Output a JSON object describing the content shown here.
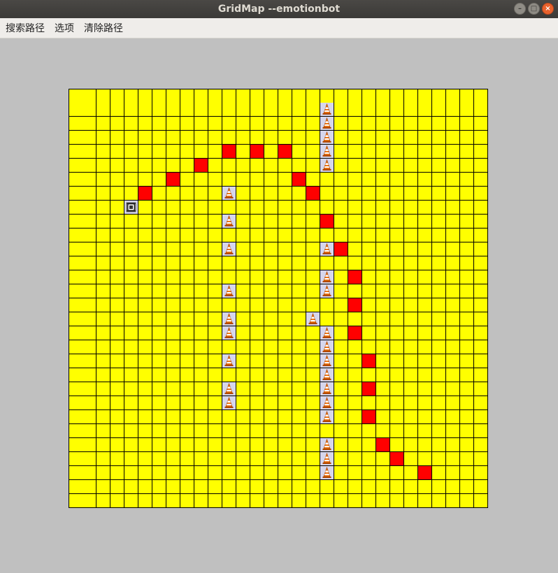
{
  "window": {
    "title": "GridMap --emotionbot"
  },
  "menu": {
    "items": [
      "搜索路径",
      "选项",
      "清除路径"
    ]
  },
  "colors": {
    "free": "#ffff00",
    "path": "#ff0000",
    "obstacle_bg": "#d6d6ec",
    "background": "#c0c0c0",
    "grid_line": "#000000"
  },
  "grid": {
    "rows": 30,
    "cols": 30,
    "robot": [
      8,
      4
    ],
    "obstacles": [
      [
        1,
        18
      ],
      [
        2,
        18
      ],
      [
        3,
        18
      ],
      [
        4,
        18
      ],
      [
        5,
        18
      ],
      [
        7,
        11
      ],
      [
        9,
        11
      ],
      [
        11,
        11
      ],
      [
        11,
        18
      ],
      [
        13,
        18
      ],
      [
        14,
        11
      ],
      [
        14,
        18
      ],
      [
        16,
        11
      ],
      [
        16,
        17
      ],
      [
        17,
        11
      ],
      [
        17,
        18
      ],
      [
        18,
        18
      ],
      [
        19,
        11
      ],
      [
        19,
        18
      ],
      [
        20,
        18
      ],
      [
        21,
        11
      ],
      [
        21,
        18
      ],
      [
        22,
        11
      ],
      [
        22,
        18
      ],
      [
        23,
        18
      ],
      [
        25,
        18
      ],
      [
        26,
        18
      ],
      [
        27,
        18
      ]
    ],
    "path": [
      [
        4,
        11
      ],
      [
        4,
        13
      ],
      [
        4,
        15
      ],
      [
        5,
        9
      ],
      [
        6,
        7
      ],
      [
        6,
        16
      ],
      [
        7,
        5
      ],
      [
        7,
        17
      ],
      [
        9,
        18
      ],
      [
        11,
        19
      ],
      [
        13,
        20
      ],
      [
        15,
        20
      ],
      [
        17,
        20
      ],
      [
        19,
        21
      ],
      [
        21,
        21
      ],
      [
        23,
        21
      ],
      [
        25,
        22
      ],
      [
        26,
        23
      ],
      [
        27,
        25
      ]
    ]
  }
}
